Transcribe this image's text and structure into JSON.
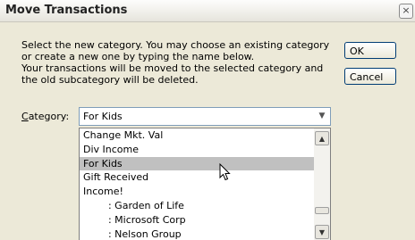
{
  "dialog": {
    "title": "Move Transactions",
    "close_glyph": "×",
    "message_lines": [
      "Select the new category. You may choose an existing category",
      "or create a new one by typing the name below.",
      "Your transactions will be moved to the selected category and",
      "the old subcategory will be deleted."
    ],
    "ok_label": "OK",
    "cancel_label": "Cancel",
    "category_label_mnemonic": "C",
    "category_label_rest": "ategory:",
    "category_value": "For Kids"
  },
  "dropdown": {
    "items": [
      "Change Mkt. Val",
      "Div Income",
      "For Kids",
      "Gift Received",
      "Income!",
      "        : Garden of Life",
      "        : Microsoft Corp",
      "        : Nelson Group"
    ],
    "selected_index": 2
  },
  "icons": {
    "close": "close-icon",
    "combo_arrow": "chevron-down-icon",
    "scroll_up": "scroll-up-icon",
    "scroll_down": "scroll-down-icon",
    "cursor": "mouse-pointer-icon"
  }
}
